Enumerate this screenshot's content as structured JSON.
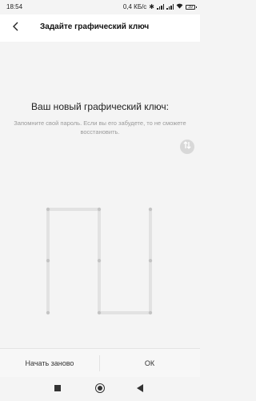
{
  "status": {
    "time": "18:54",
    "speed": "0,4 КБ/с",
    "battery": "39"
  },
  "header": {
    "title": "Задайте графический ключ"
  },
  "main": {
    "headline": "Ваш новый графический ключ:",
    "hint": "Запомните свой пароль. Если вы его забудете, то не сможете восстановить."
  },
  "pattern": {
    "grid_size": 3,
    "path_sequence": [
      7,
      4,
      1,
      2,
      5,
      8,
      9,
      6,
      3
    ],
    "colors": {
      "line": "#e2e2e2",
      "dot": "#c4c4c4"
    }
  },
  "bottom": {
    "restart_label": "Начать заново",
    "ok_label": "ОК"
  },
  "icons": {
    "back": "back-arrow-icon",
    "swap": "swap-vertical-icon",
    "nav_recents": "recents-square-icon",
    "nav_home": "home-circle-icon",
    "nav_back": "back-triangle-icon"
  }
}
